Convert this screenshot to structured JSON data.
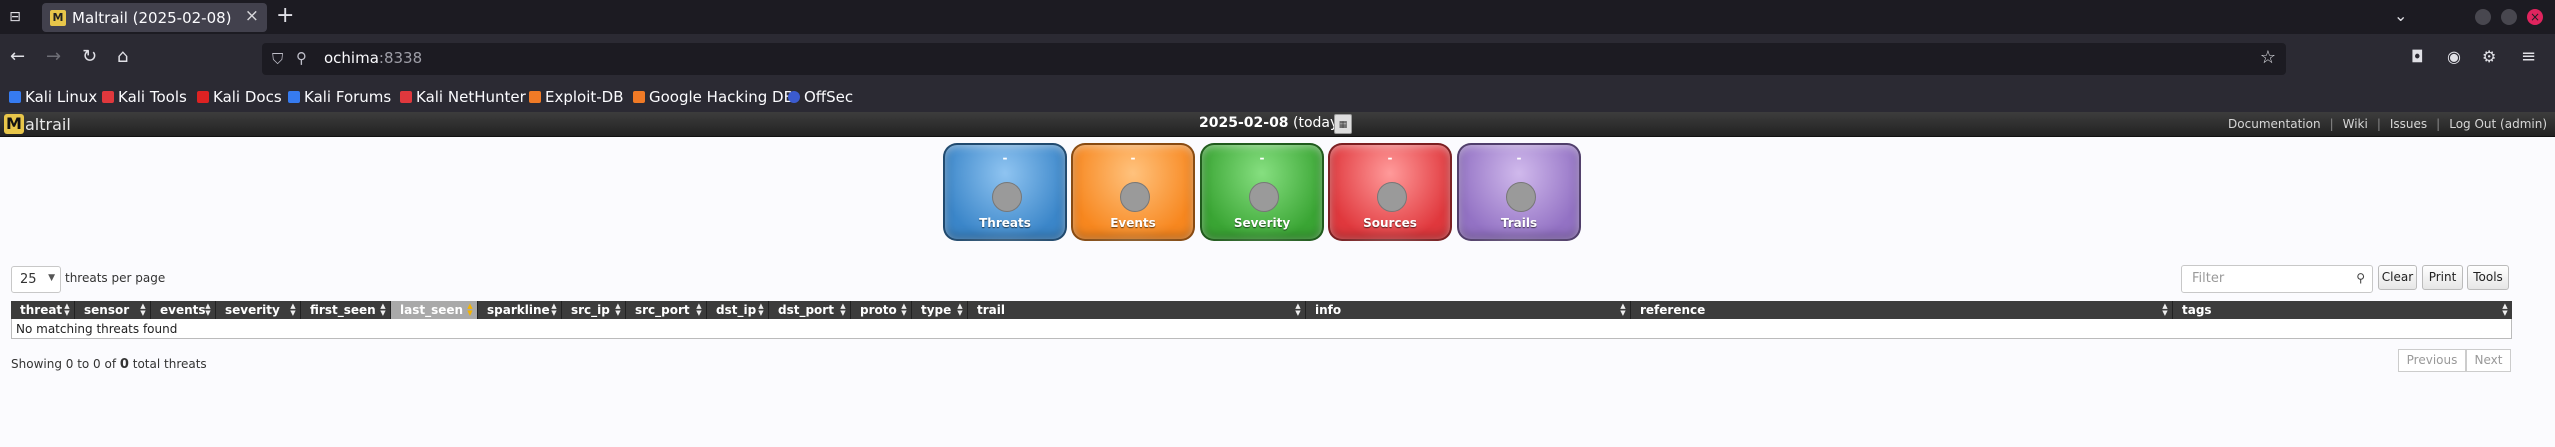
{
  "browser": {
    "tab_title": "Maltrail (2025-02-08)",
    "url_host": "ochima",
    "url_port": ":8338",
    "bookmarks": [
      "Kali Linux",
      "Kali Tools",
      "Kali Docs",
      "Kali Forums",
      "Kali NetHunter",
      "Exploit-DB",
      "Google Hacking DB",
      "OffSec"
    ]
  },
  "header": {
    "logo_mark": "M",
    "logo_text": "altrail",
    "date": "2025-02-08",
    "date_suffix": " (today)",
    "links": [
      "Documentation",
      "Wiki",
      "Issues",
      "Log Out (admin)"
    ]
  },
  "counters": [
    {
      "label": "Threats",
      "value": "-"
    },
    {
      "label": "Events",
      "value": "-"
    },
    {
      "label": "Severity",
      "value": "-"
    },
    {
      "label": "Sources",
      "value": "-"
    },
    {
      "label": "Trails",
      "value": "-"
    }
  ],
  "controls": {
    "page_length": "25",
    "page_length_label": "threats per page",
    "filter_placeholder": "Filter",
    "buttons": [
      "Clear",
      "Print",
      "Tools"
    ]
  },
  "table": {
    "columns": [
      "threat",
      "sensor",
      "events",
      "severity",
      "first_seen",
      "last_seen",
      "sparkline",
      "src_ip",
      "src_port",
      "dst_ip",
      "dst_port",
      "proto",
      "type",
      "trail",
      "info",
      "reference",
      "tags"
    ],
    "sorted_column": "last_seen",
    "empty_message": "No matching threats found"
  },
  "footer": {
    "info_prefix": "Showing 0 to 0 of ",
    "total": "0",
    "info_suffix": " total threats",
    "previous": "Previous",
    "next": "Next"
  },
  "colors": {
    "threats": "#3b86c9",
    "events": "#f7871f",
    "severity": "#3aa534",
    "sources": "#e0383d",
    "trails": "#9372c4"
  }
}
